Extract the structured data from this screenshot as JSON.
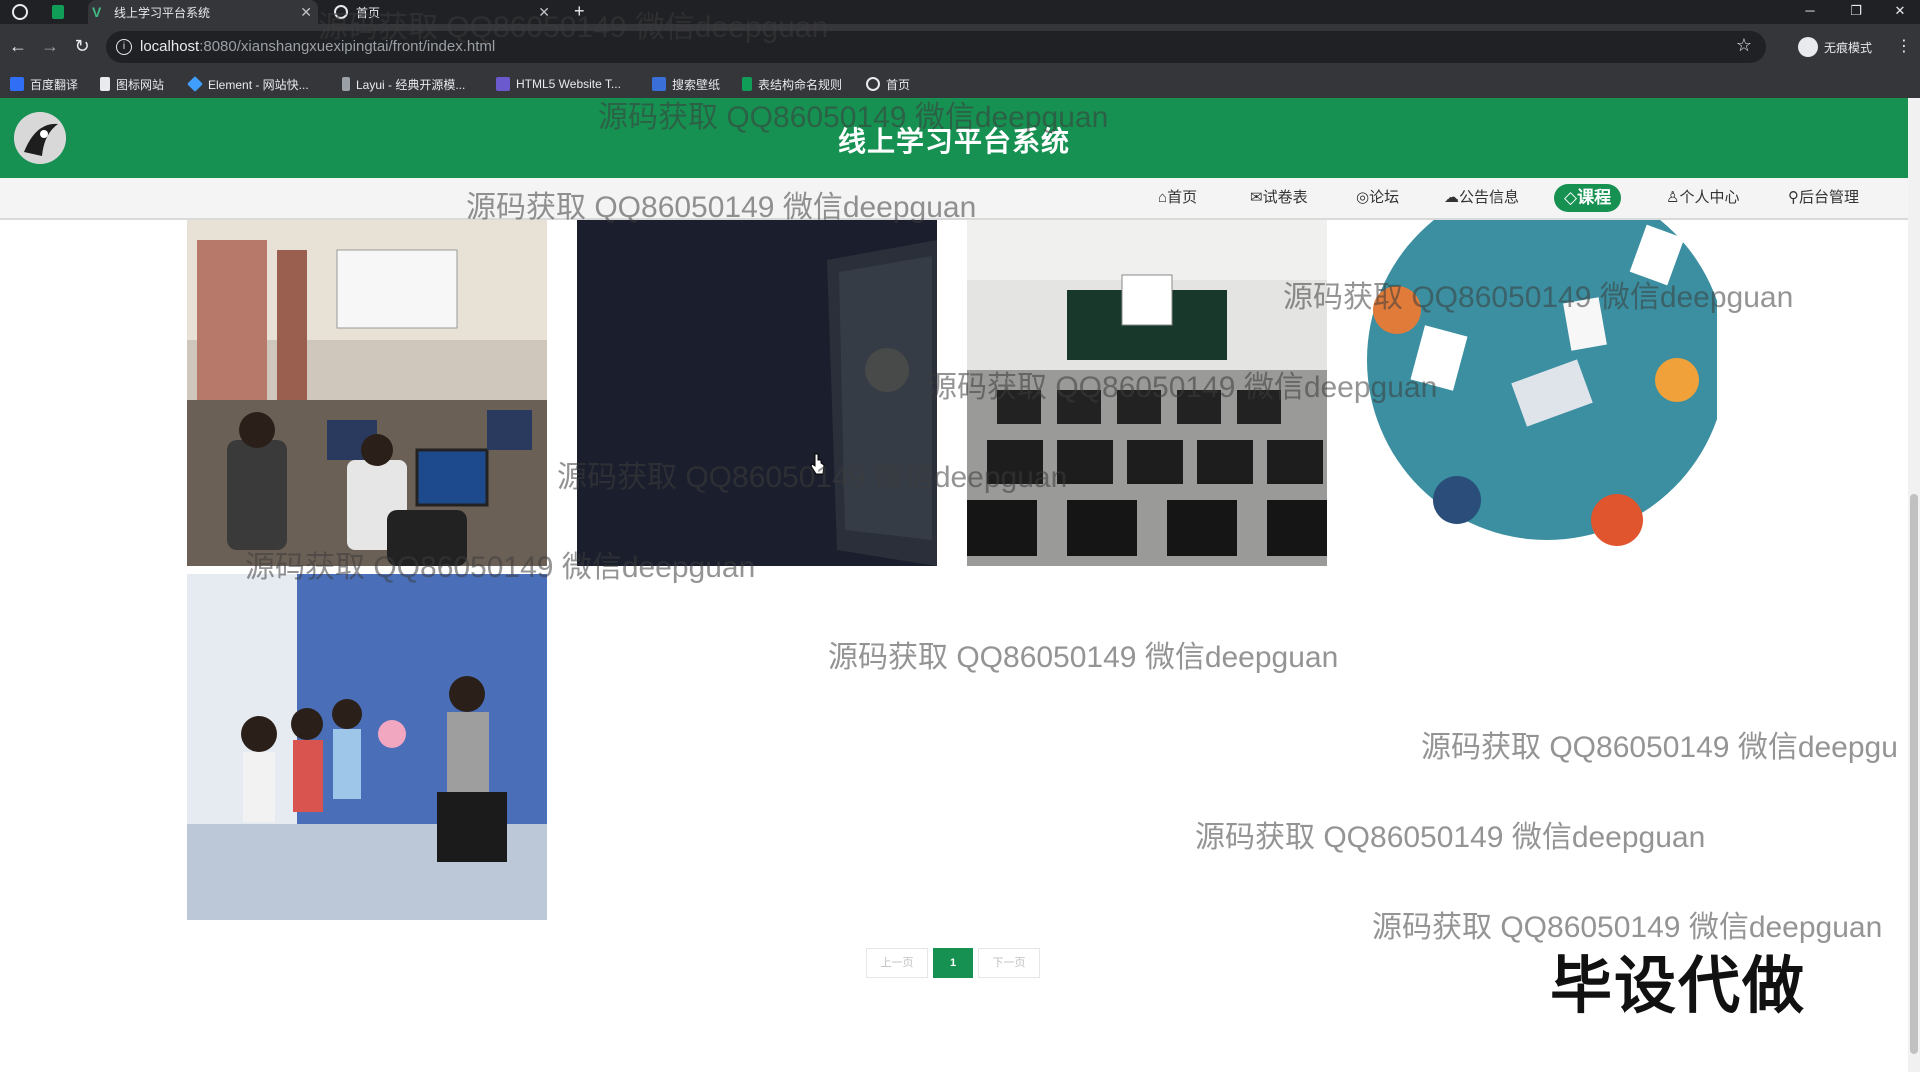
{
  "browser": {
    "tabs": [
      {
        "label": "线上学习平台系统"
      },
      {
        "label": "首页"
      }
    ],
    "new_tab": "+",
    "url_host": "localhost",
    "url_path": ":8080/xianshangxuexipingtai/front/index.html",
    "profile_label": "无痕模式",
    "bookmarks": [
      {
        "label": "百度翻译"
      },
      {
        "label": "图标网站"
      },
      {
        "label": "Element - 网站快..."
      },
      {
        "label": "Layui - 经典开源模..."
      },
      {
        "label": "HTML5 Website T..."
      },
      {
        "label": "搜索壁纸"
      },
      {
        "label": "表结构命名规则"
      },
      {
        "label": "首页"
      }
    ]
  },
  "header": {
    "title": "线上学习平台系统"
  },
  "nav": {
    "items": [
      {
        "label": "首页",
        "icon": "home-icon"
      },
      {
        "label": "试卷表",
        "icon": "mail-icon"
      },
      {
        "label": "论坛",
        "icon": "globe-icon"
      },
      {
        "label": "公告信息",
        "icon": "cloud-icon"
      },
      {
        "label": "课程",
        "icon": "tag-icon",
        "active": true
      },
      {
        "label": "个人中心",
        "icon": "user-icon"
      },
      {
        "label": "后台管理",
        "icon": "link-icon"
      }
    ]
  },
  "courses": [
    {
      "image": "computer-lab-students"
    },
    {
      "image": "dark-screen-presentation"
    },
    {
      "image": "classroom-monitors"
    },
    {
      "image": "team-meeting-illustration"
    },
    {
      "image": "teacher-with-children"
    }
  ],
  "pagination": {
    "prev": "上一页",
    "current": "1",
    "next": "下一页"
  },
  "overlay": {
    "watermark_text": "源码获取 QQ86050149 微信deepguan",
    "watermark_cut": "源码获取 QQ86050149 微信deepgu",
    "stamp": "毕设代做"
  },
  "colors": {
    "brand": "#179152",
    "chrome": "#35363a"
  }
}
